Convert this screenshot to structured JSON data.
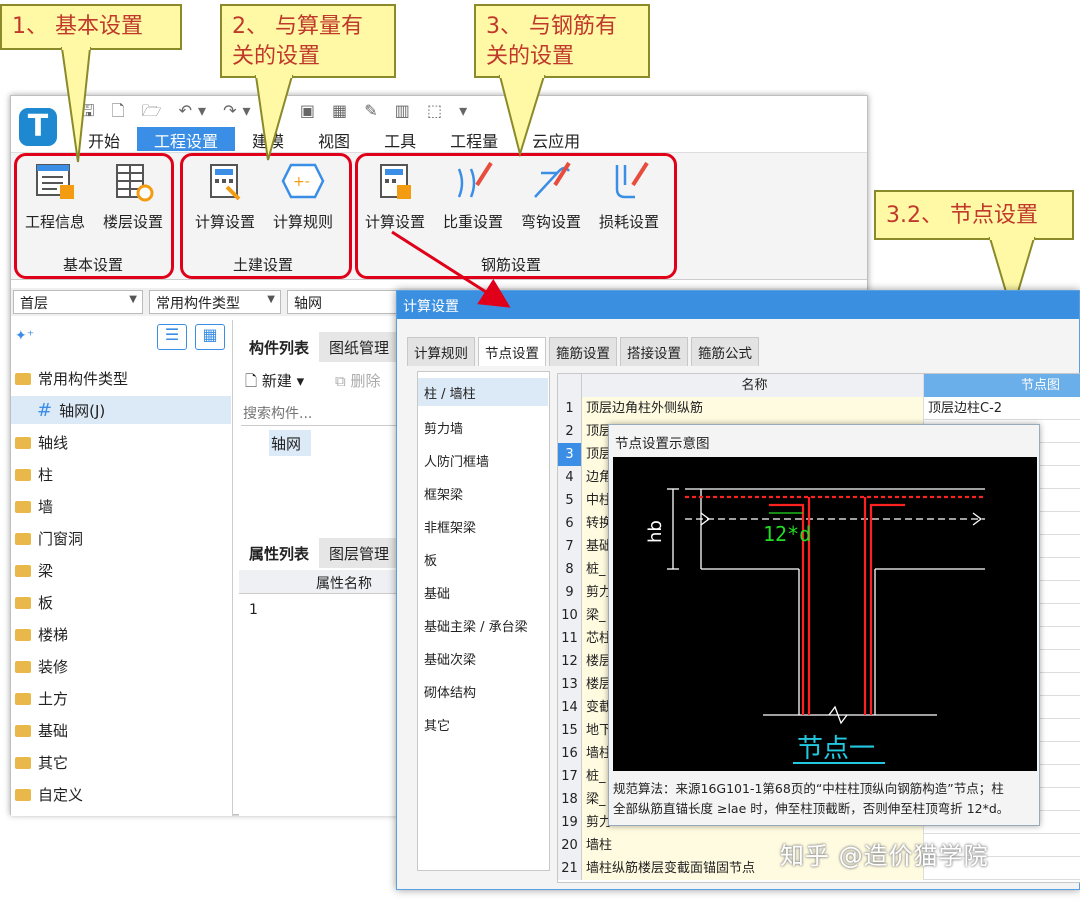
{
  "callouts": {
    "c1": "1、 基本设置",
    "c2_line1": "2、 与算量有",
    "c2_line2": "关的设置",
    "c3_line1": "3、 与钢筋有",
    "c3_line2": "关的设置",
    "c32": "3.2、 节点设置"
  },
  "app": {
    "logo": "T",
    "menus": [
      "开始",
      "工程设置",
      "建模",
      "视图",
      "工具",
      "工程量",
      "云应用"
    ],
    "active_menu": "工程设置",
    "ribbon": {
      "basic": {
        "buttons": [
          "工程信息",
          "楼层设置"
        ],
        "group": "基本设置"
      },
      "civil": {
        "buttons": [
          "计算设置",
          "计算规则"
        ],
        "group": "土建设置"
      },
      "rebar": {
        "buttons": [
          "计算设置",
          "比重设置",
          "弯钩设置",
          "损耗设置"
        ],
        "group": "钢筋设置"
      }
    },
    "combos": [
      "首层",
      "常用构件类型",
      "轴网"
    ],
    "tree": [
      "常用构件类型",
      "轴网(J)",
      "轴线",
      "柱",
      "墙",
      "门窗洞",
      "梁",
      "板",
      "楼梯",
      "装修",
      "土方",
      "基础",
      "其它",
      "自定义"
    ],
    "mid": {
      "tab1": "构件列表",
      "tab2": "图纸管理",
      "new_btn": "新建",
      "del_btn": "删除",
      "search_placeholder": "搜索构件...",
      "item": "轴网",
      "prop_tab1": "属性列表",
      "prop_tab2": "图层管理",
      "prop_header": "属性名称",
      "prop_row": "1"
    }
  },
  "dialog": {
    "title": "计算设置",
    "tabs": [
      "计算规则",
      "节点设置",
      "箍筋设置",
      "搭接设置",
      "箍筋公式"
    ],
    "active_tab": "节点设置",
    "categories": [
      "柱 / 墙柱",
      "剪力墙",
      "人防门框墙",
      "框架梁",
      "非框架梁",
      "板",
      "基础",
      "基础主梁 / 承台梁",
      "基础次梁",
      "砌体结构",
      "其它"
    ],
    "grid": {
      "col_name": "名称",
      "col_img": "节点图",
      "rows": [
        {
          "n": "1",
          "name": "顶层边角柱外侧纵筋",
          "img": "顶层边柱C-2"
        },
        {
          "n": "2",
          "name": "顶层",
          "img": ""
        },
        {
          "n": "3",
          "name": "顶层",
          "img": ""
        },
        {
          "n": "4",
          "name": "边角",
          "img": ""
        },
        {
          "n": "5",
          "name": "中柱",
          "img": ""
        },
        {
          "n": "6",
          "name": "转换",
          "img": ""
        },
        {
          "n": "7",
          "name": "基础",
          "img": ""
        },
        {
          "n": "8",
          "name": "桩_",
          "img": ""
        },
        {
          "n": "9",
          "name": "剪力",
          "img": ""
        },
        {
          "n": "10",
          "name": "梁_",
          "img": ""
        },
        {
          "n": "11",
          "name": "芯柱",
          "img": ""
        },
        {
          "n": "12",
          "name": "楼层",
          "img": ""
        },
        {
          "n": "13",
          "name": "楼层",
          "img": ""
        },
        {
          "n": "14",
          "name": "变截",
          "img": ""
        },
        {
          "n": "15",
          "name": "地下",
          "img": ""
        },
        {
          "n": "16",
          "name": "墙柱",
          "img": ""
        },
        {
          "n": "17",
          "name": "桩_",
          "img": ""
        },
        {
          "n": "18",
          "name": "梁_",
          "img": ""
        },
        {
          "n": "19",
          "name": "剪力",
          "img": ""
        },
        {
          "n": "20",
          "name": "墙柱",
          "img": ""
        },
        {
          "n": "21",
          "name": "墙柱纵筋楼层变截面锚固节点",
          "img": ""
        }
      ]
    }
  },
  "node_preview": {
    "title": "节点设置示意图",
    "label_hb": "hb",
    "label_12d": "12*d",
    "caption": "节点一",
    "desc_line1": "规范算法：来源16G101-1第68页的“中柱柱顶纵向钢筋构造”节点；柱",
    "desc_line2": "全部纵筋直锚长度 ≥lae 时，伸至柱顶截断，否则伸至柱顶弯折 12*d。"
  },
  "watermark": "知乎 @造价猫学院",
  "colors": {
    "accent": "#3a8ee6",
    "highlight": "#e0001a",
    "callout_bg": "#fff9a6",
    "rebar_red": "#ff2020",
    "dim_green": "#22dd22",
    "caption_cyan": "#22c8e0"
  }
}
